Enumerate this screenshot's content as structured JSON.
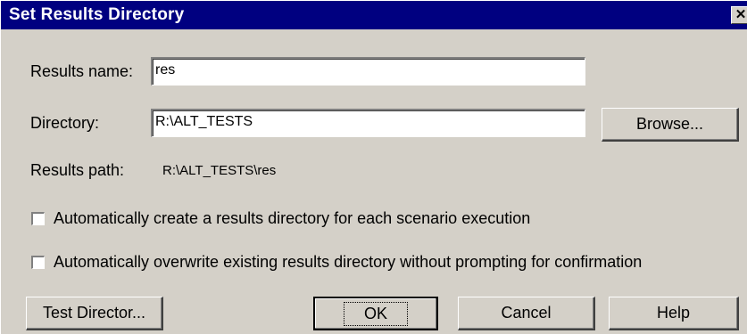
{
  "dialog": {
    "title": "Set Results Directory",
    "close_glyph": "✕"
  },
  "fields": {
    "results_name_label": "Results name:",
    "results_name_value": "res",
    "directory_label": "Directory:",
    "directory_value": "R:\\ALT_TESTS",
    "results_path_label": "Results path:",
    "results_path_value": "R:\\ALT_TESTS\\res"
  },
  "checkboxes": [
    {
      "label": "Automatically create a results directory for each scenario execution",
      "checked": false
    },
    {
      "label": "Automatically overwrite existing results directory without prompting for confirmation",
      "checked": false
    }
  ],
  "buttons": {
    "browse": "Browse...",
    "test_director": "Test Director...",
    "ok": "OK",
    "cancel": "Cancel",
    "help": "Help"
  }
}
